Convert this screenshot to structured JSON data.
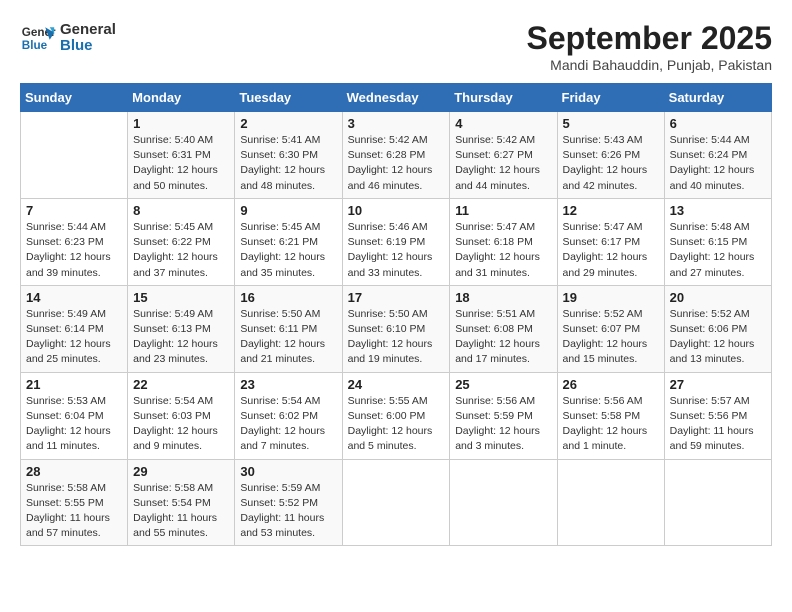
{
  "logo": {
    "line1": "General",
    "line2": "Blue"
  },
  "title": "September 2025",
  "subtitle": "Mandi Bahauddin, Punjab, Pakistan",
  "days_of_week": [
    "Sunday",
    "Monday",
    "Tuesday",
    "Wednesday",
    "Thursday",
    "Friday",
    "Saturday"
  ],
  "weeks": [
    [
      {
        "day": "",
        "detail": ""
      },
      {
        "day": "1",
        "detail": "Sunrise: 5:40 AM\nSunset: 6:31 PM\nDaylight: 12 hours\nand 50 minutes."
      },
      {
        "day": "2",
        "detail": "Sunrise: 5:41 AM\nSunset: 6:30 PM\nDaylight: 12 hours\nand 48 minutes."
      },
      {
        "day": "3",
        "detail": "Sunrise: 5:42 AM\nSunset: 6:28 PM\nDaylight: 12 hours\nand 46 minutes."
      },
      {
        "day": "4",
        "detail": "Sunrise: 5:42 AM\nSunset: 6:27 PM\nDaylight: 12 hours\nand 44 minutes."
      },
      {
        "day": "5",
        "detail": "Sunrise: 5:43 AM\nSunset: 6:26 PM\nDaylight: 12 hours\nand 42 minutes."
      },
      {
        "day": "6",
        "detail": "Sunrise: 5:44 AM\nSunset: 6:24 PM\nDaylight: 12 hours\nand 40 minutes."
      }
    ],
    [
      {
        "day": "7",
        "detail": "Sunrise: 5:44 AM\nSunset: 6:23 PM\nDaylight: 12 hours\nand 39 minutes."
      },
      {
        "day": "8",
        "detail": "Sunrise: 5:45 AM\nSunset: 6:22 PM\nDaylight: 12 hours\nand 37 minutes."
      },
      {
        "day": "9",
        "detail": "Sunrise: 5:45 AM\nSunset: 6:21 PM\nDaylight: 12 hours\nand 35 minutes."
      },
      {
        "day": "10",
        "detail": "Sunrise: 5:46 AM\nSunset: 6:19 PM\nDaylight: 12 hours\nand 33 minutes."
      },
      {
        "day": "11",
        "detail": "Sunrise: 5:47 AM\nSunset: 6:18 PM\nDaylight: 12 hours\nand 31 minutes."
      },
      {
        "day": "12",
        "detail": "Sunrise: 5:47 AM\nSunset: 6:17 PM\nDaylight: 12 hours\nand 29 minutes."
      },
      {
        "day": "13",
        "detail": "Sunrise: 5:48 AM\nSunset: 6:15 PM\nDaylight: 12 hours\nand 27 minutes."
      }
    ],
    [
      {
        "day": "14",
        "detail": "Sunrise: 5:49 AM\nSunset: 6:14 PM\nDaylight: 12 hours\nand 25 minutes."
      },
      {
        "day": "15",
        "detail": "Sunrise: 5:49 AM\nSunset: 6:13 PM\nDaylight: 12 hours\nand 23 minutes."
      },
      {
        "day": "16",
        "detail": "Sunrise: 5:50 AM\nSunset: 6:11 PM\nDaylight: 12 hours\nand 21 minutes."
      },
      {
        "day": "17",
        "detail": "Sunrise: 5:50 AM\nSunset: 6:10 PM\nDaylight: 12 hours\nand 19 minutes."
      },
      {
        "day": "18",
        "detail": "Sunrise: 5:51 AM\nSunset: 6:08 PM\nDaylight: 12 hours\nand 17 minutes."
      },
      {
        "day": "19",
        "detail": "Sunrise: 5:52 AM\nSunset: 6:07 PM\nDaylight: 12 hours\nand 15 minutes."
      },
      {
        "day": "20",
        "detail": "Sunrise: 5:52 AM\nSunset: 6:06 PM\nDaylight: 12 hours\nand 13 minutes."
      }
    ],
    [
      {
        "day": "21",
        "detail": "Sunrise: 5:53 AM\nSunset: 6:04 PM\nDaylight: 12 hours\nand 11 minutes."
      },
      {
        "day": "22",
        "detail": "Sunrise: 5:54 AM\nSunset: 6:03 PM\nDaylight: 12 hours\nand 9 minutes."
      },
      {
        "day": "23",
        "detail": "Sunrise: 5:54 AM\nSunset: 6:02 PM\nDaylight: 12 hours\nand 7 minutes."
      },
      {
        "day": "24",
        "detail": "Sunrise: 5:55 AM\nSunset: 6:00 PM\nDaylight: 12 hours\nand 5 minutes."
      },
      {
        "day": "25",
        "detail": "Sunrise: 5:56 AM\nSunset: 5:59 PM\nDaylight: 12 hours\nand 3 minutes."
      },
      {
        "day": "26",
        "detail": "Sunrise: 5:56 AM\nSunset: 5:58 PM\nDaylight: 12 hours\nand 1 minute."
      },
      {
        "day": "27",
        "detail": "Sunrise: 5:57 AM\nSunset: 5:56 PM\nDaylight: 11 hours\nand 59 minutes."
      }
    ],
    [
      {
        "day": "28",
        "detail": "Sunrise: 5:58 AM\nSunset: 5:55 PM\nDaylight: 11 hours\nand 57 minutes."
      },
      {
        "day": "29",
        "detail": "Sunrise: 5:58 AM\nSunset: 5:54 PM\nDaylight: 11 hours\nand 55 minutes."
      },
      {
        "day": "30",
        "detail": "Sunrise: 5:59 AM\nSunset: 5:52 PM\nDaylight: 11 hours\nand 53 minutes."
      },
      {
        "day": "",
        "detail": ""
      },
      {
        "day": "",
        "detail": ""
      },
      {
        "day": "",
        "detail": ""
      },
      {
        "day": "",
        "detail": ""
      }
    ]
  ]
}
